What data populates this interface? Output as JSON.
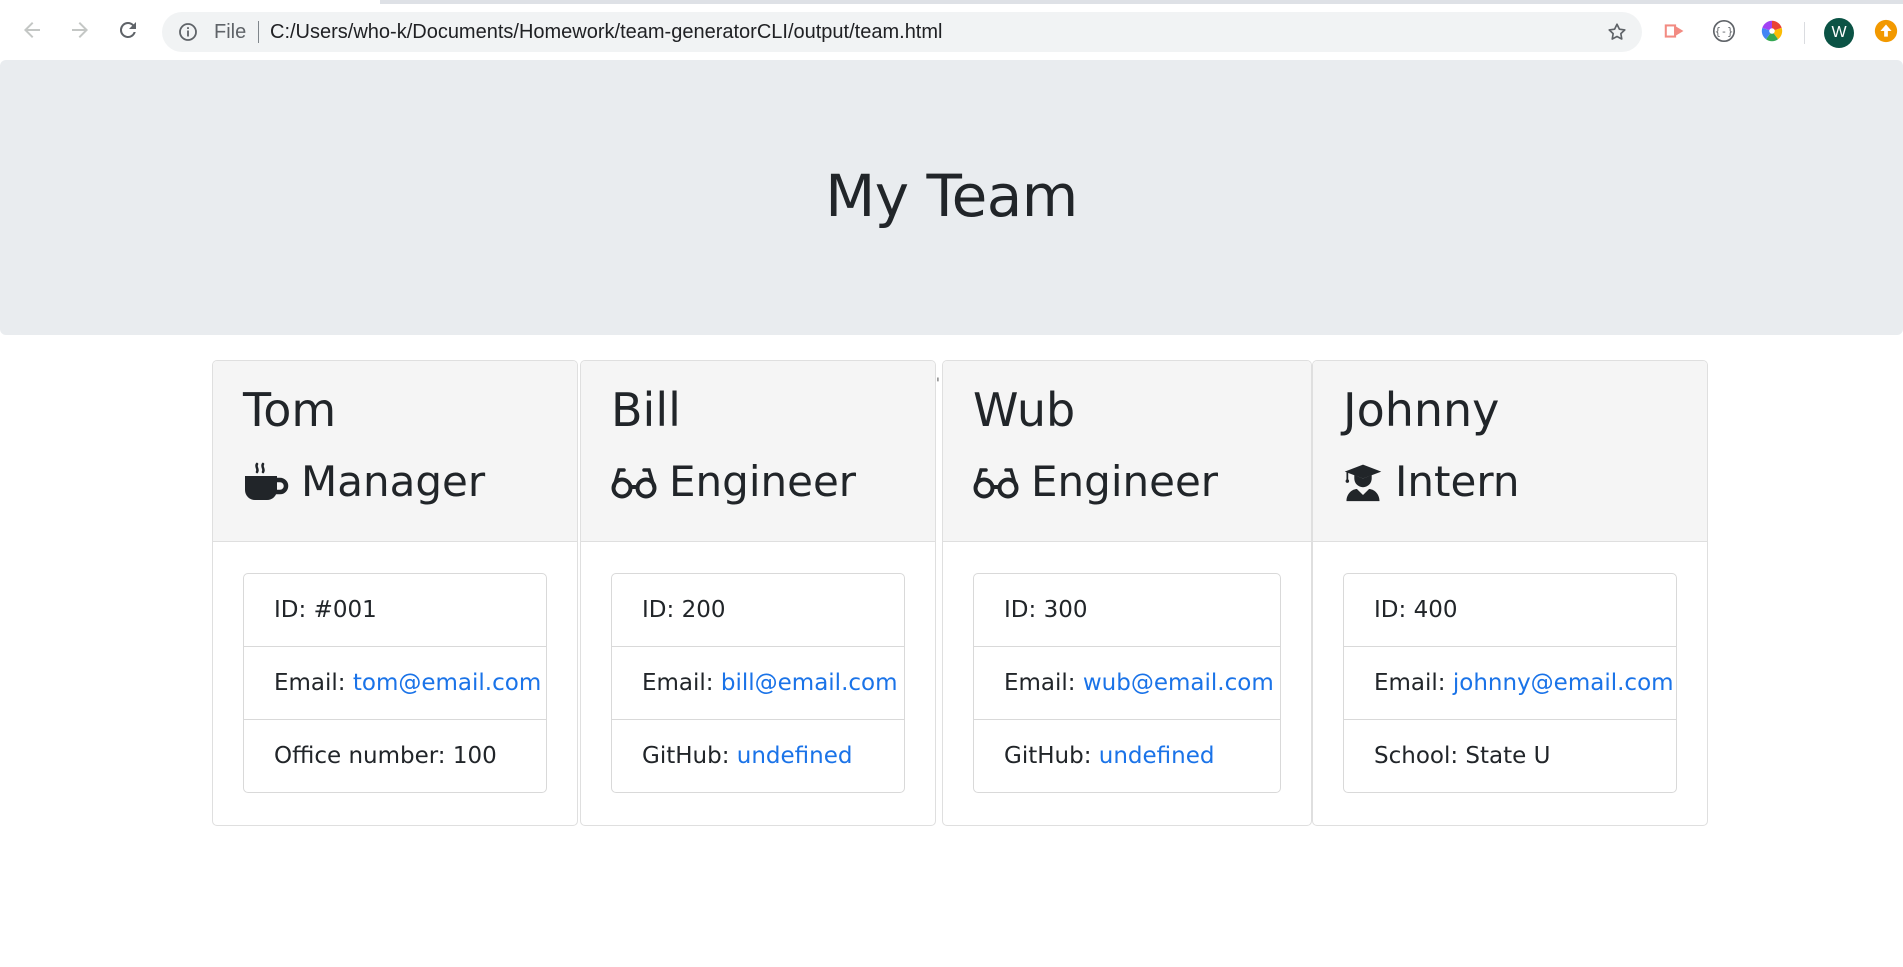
{
  "browser": {
    "scheme_label": "File",
    "url": "C:/Users/who-k/Documents/Homework/team-generatorCLI/output/team.html",
    "avatar_letter": "W",
    "icons": {
      "back": "arrow-left-icon",
      "forward": "arrow-right-icon",
      "reload": "reload-icon",
      "info": "info-icon",
      "bookmark": "star-icon",
      "ext1": "cast-arrow-icon",
      "ext2": "code-braces-icon",
      "ext3": "color-wheel-icon",
      "ext4": "orange-arrow-icon"
    }
  },
  "jumbotron": {
    "title": "My Team"
  },
  "members": [
    {
      "name": "Tom",
      "role": "Manager",
      "role_icon": "coffee-icon",
      "id_label": "ID:",
      "id_value": "#001",
      "email_label": "Email:",
      "email": "tom@email.com",
      "extra_label": "Office number:",
      "extra_value": "100",
      "extra_is_link": false
    },
    {
      "name": "Bill",
      "role": "Engineer",
      "role_icon": "glasses-icon",
      "id_label": "ID:",
      "id_value": "200",
      "email_label": "Email:",
      "email": "bill@email.com",
      "extra_label": "GitHub:",
      "extra_value": "undefined",
      "extra_is_link": true
    },
    {
      "name": "Wub",
      "role": "Engineer",
      "role_icon": "glasses-icon",
      "id_label": "ID:",
      "id_value": "300",
      "email_label": "Email:",
      "email": "wub@email.com",
      "extra_label": "GitHub:",
      "extra_value": "undefined",
      "extra_is_link": true
    },
    {
      "name": "Johnny",
      "role": "Intern",
      "role_icon": "graduate-icon",
      "id_label": "ID:",
      "id_value": "400",
      "email_label": "Email:",
      "email": "johnny@email.com",
      "extra_label": "School:",
      "extra_value": "State U",
      "extra_is_link": false
    }
  ],
  "colors": {
    "link": "#1a73e8",
    "jumbotron_bg": "#e9ecef",
    "card_header_bg": "#f5f5f5",
    "avatar_bg": "#0b5345"
  }
}
